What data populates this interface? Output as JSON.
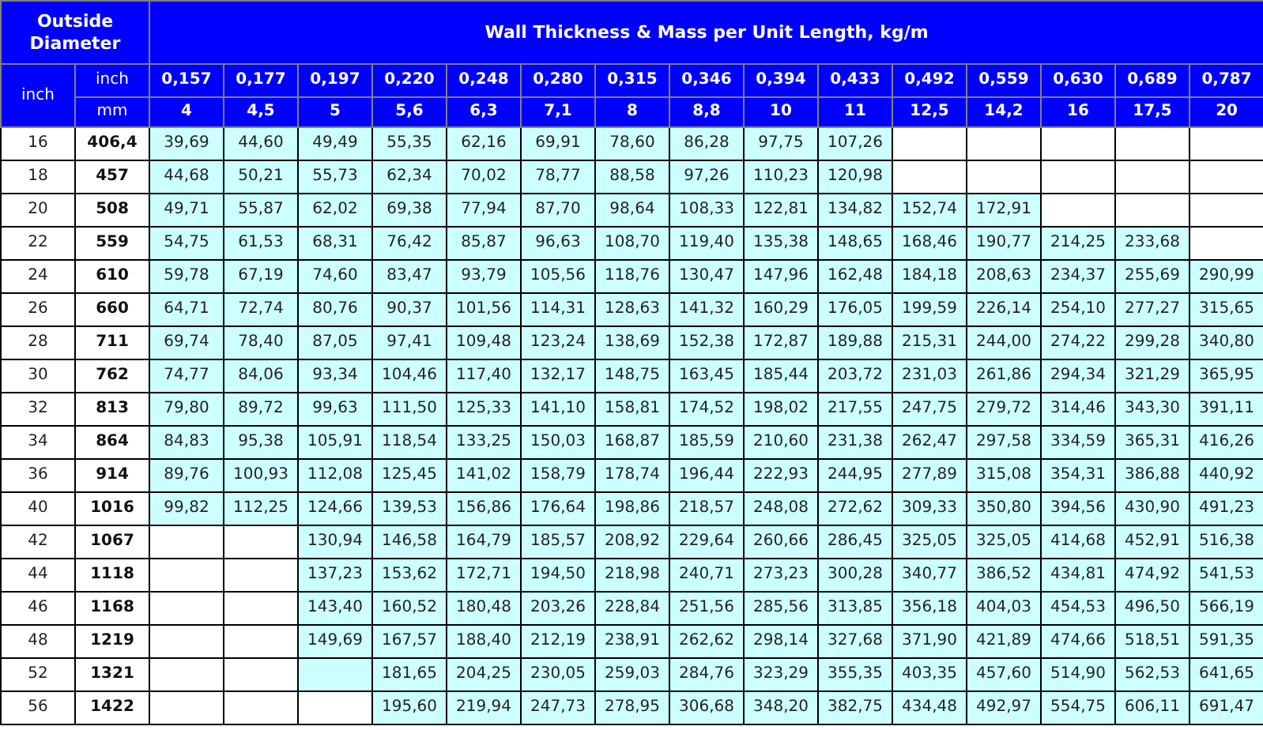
{
  "header": {
    "diameter_title": "Outside Diameter",
    "mass_title": "Wall Thickness & Mass per Unit Length, kg/m",
    "diameter_unit": "inch",
    "inch_label": "inch",
    "mm_label": "mm"
  },
  "thickness_inch": [
    "0,157",
    "0,177",
    "0,197",
    "0,220",
    "0,248",
    "0,280",
    "0,315",
    "0,346",
    "0,394",
    "0,433",
    "0,492",
    "0,559",
    "0,630",
    "0,689",
    "0,787"
  ],
  "thickness_mm": [
    "4",
    "4,5",
    "5",
    "5,6",
    "6,3",
    "7,1",
    "8",
    "8,8",
    "10",
    "11",
    "12,5",
    "14,2",
    "16",
    "17,5",
    "20"
  ],
  "rows": [
    {
      "inch": "16",
      "mm": "406,4",
      "values": [
        "39,69",
        "44,60",
        "49,49",
        "55,35",
        "62,16",
        "69,91",
        "78,60",
        "86,28",
        "97,75",
        "107,26"
      ],
      "empty_after": [
        {
          "kind": "empty"
        },
        {
          "kind": "empty"
        },
        {
          "kind": "empty"
        },
        {
          "kind": "empty"
        },
        {
          "kind": "empty"
        }
      ]
    },
    {
      "inch": "18",
      "mm": "457",
      "values": [
        "44,68",
        "50,21",
        "55,73",
        "62,34",
        "70,02",
        "78,77",
        "88,58",
        "97,26",
        "110,23",
        "120,98"
      ],
      "empty_after": [
        {
          "kind": "empty"
        },
        {
          "kind": "empty"
        },
        {
          "kind": "empty"
        },
        {
          "kind": "empty"
        },
        {
          "kind": "empty"
        }
      ]
    },
    {
      "inch": "20",
      "mm": "508",
      "values": [
        "49,71",
        "55,87",
        "62,02",
        "69,38",
        "77,94",
        "87,70",
        "98,64",
        "108,33",
        "122,81",
        "134,82",
        "152,74",
        "172,91"
      ],
      "empty_after": [
        {
          "kind": "empty"
        },
        {
          "kind": "empty"
        },
        {
          "kind": "empty"
        }
      ]
    },
    {
      "inch": "22",
      "mm": "559",
      "values": [
        "54,75",
        "61,53",
        "68,31",
        "76,42",
        "85,87",
        "96,63",
        "108,70",
        "119,40",
        "135,38",
        "148,65",
        "168,46",
        "190,77",
        "214,25",
        "233,68"
      ],
      "empty_after": [
        {
          "kind": "empty"
        }
      ]
    },
    {
      "inch": "24",
      "mm": "610",
      "values": [
        "59,78",
        "67,19",
        "74,60",
        "83,47",
        "93,79",
        "105,56",
        "118,76",
        "130,47",
        "147,96",
        "162,48",
        "184,18",
        "208,63",
        "234,37",
        "255,69",
        "290,99"
      ]
    },
    {
      "inch": "26",
      "mm": "660",
      "values": [
        "64,71",
        "72,74",
        "80,76",
        "90,37",
        "101,56",
        "114,31",
        "128,63",
        "141,32",
        "160,29",
        "176,05",
        "199,59",
        "226,14",
        "254,10",
        "277,27",
        "315,65"
      ]
    },
    {
      "inch": "28",
      "mm": "711",
      "values": [
        "69,74",
        "78,40",
        "87,05",
        "97,41",
        "109,48",
        "123,24",
        "138,69",
        "152,38",
        "172,87",
        "189,88",
        "215,31",
        "244,00",
        "274,22",
        "299,28",
        "340,80"
      ]
    },
    {
      "inch": "30",
      "mm": "762",
      "values": [
        "74,77",
        "84,06",
        "93,34",
        "104,46",
        "117,40",
        "132,17",
        "148,75",
        "163,45",
        "185,44",
        "203,72",
        "231,03",
        "261,86",
        "294,34",
        "321,29",
        "365,95"
      ]
    },
    {
      "inch": "32",
      "mm": "813",
      "values": [
        "79,80",
        "89,72",
        "99,63",
        "111,50",
        "125,33",
        "141,10",
        "158,81",
        "174,52",
        "198,02",
        "217,55",
        "247,75",
        "279,72",
        "314,46",
        "343,30",
        "391,11"
      ]
    },
    {
      "inch": "34",
      "mm": "864",
      "values": [
        "84,83",
        "95,38",
        "105,91",
        "118,54",
        "133,25",
        "150,03",
        "168,87",
        "185,59",
        "210,60",
        "231,38",
        "262,47",
        "297,58",
        "334,59",
        "365,31",
        "416,26"
      ]
    },
    {
      "inch": "36",
      "mm": "914",
      "values": [
        "89,76",
        "100,93",
        "112,08",
        "125,45",
        "141,02",
        "158,79",
        "178,74",
        "196,44",
        "222,93",
        "244,95",
        "277,89",
        "315,08",
        "354,31",
        "386,88",
        "440,92"
      ]
    },
    {
      "inch": "40",
      "mm": "1016",
      "values": [
        "99,82",
        "112,25",
        "124,66",
        "139,53",
        "156,86",
        "176,64",
        "198,86",
        "218,57",
        "248,08",
        "272,62",
        "309,33",
        "350,80",
        "394,56",
        "430,90",
        "491,23"
      ]
    },
    {
      "inch": "42",
      "mm": "1067",
      "empty_before": [
        {
          "kind": "empty"
        },
        {
          "kind": "empty"
        }
      ],
      "values": [
        "130,94",
        "146,58",
        "164,79",
        "185,57",
        "208,92",
        "229,64",
        "260,66",
        "286,45",
        "325,05",
        "325,05",
        "414,68",
        "452,91",
        "516,38"
      ]
    },
    {
      "inch": "44",
      "mm": "1118",
      "empty_before": [
        {
          "kind": "empty"
        },
        {
          "kind": "empty"
        }
      ],
      "values": [
        "137,23",
        "153,62",
        "172,71",
        "194,50",
        "218,98",
        "240,71",
        "273,23",
        "300,28",
        "340,77",
        "386,52",
        "434,81",
        "474,92",
        "541,53"
      ]
    },
    {
      "inch": "46",
      "mm": "1168",
      "empty_before": [
        {
          "kind": "empty"
        },
        {
          "kind": "empty"
        }
      ],
      "values": [
        "143,40",
        "160,52",
        "180,48",
        "203,26",
        "228,84",
        "251,56",
        "285,56",
        "313,85",
        "356,18",
        "404,03",
        "454,53",
        "496,50",
        "566,19"
      ]
    },
    {
      "inch": "48",
      "mm": "1219",
      "empty_before": [
        {
          "kind": "empty"
        },
        {
          "kind": "empty"
        }
      ],
      "values": [
        "149,69",
        "167,57",
        "188,40",
        "212,19",
        "238,91",
        "262,62",
        "298,14",
        "327,68",
        "371,90",
        "421,89",
        "474,66",
        "518,51",
        "591,35"
      ]
    },
    {
      "inch": "52",
      "mm": "1321",
      "empty_before": [
        {
          "kind": "empty"
        },
        {
          "kind": "empty"
        },
        {
          "kind": "tinted"
        }
      ],
      "values": [
        "181,65",
        "204,25",
        "230,05",
        "259,03",
        "284,76",
        "323,29",
        "355,35",
        "403,35",
        "457,60",
        "514,90",
        "562,53",
        "641,65"
      ]
    },
    {
      "inch": "56",
      "mm": "1422",
      "empty_before": [
        {
          "kind": "empty"
        },
        {
          "kind": "empty"
        },
        {
          "kind": "empty"
        }
      ],
      "values": [
        "195,60",
        "219,94",
        "247,73",
        "278,95",
        "306,68",
        "348,20",
        "382,75",
        "434,48",
        "492,97",
        "554,75",
        "606,11",
        "691,47"
      ]
    }
  ]
}
